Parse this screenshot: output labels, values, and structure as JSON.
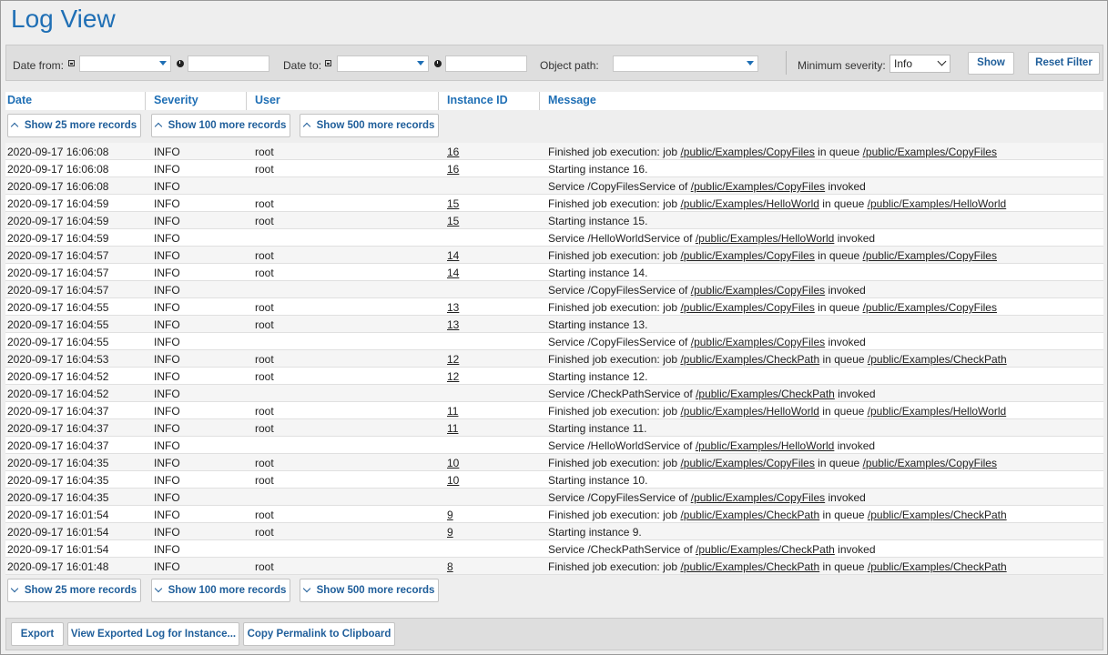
{
  "page": {
    "title": "Log View"
  },
  "filters": {
    "date_from_label": "Date from:",
    "date_to_label": "Date to:",
    "object_path_label": "Object path:",
    "min_severity_label": "Minimum severity:",
    "min_severity_value": "Info",
    "show_label": "Show",
    "reset_label": "Reset Filter"
  },
  "columns": {
    "date": "Date",
    "severity": "Severity",
    "user": "User",
    "instance": "Instance ID",
    "message": "Message"
  },
  "more_buttons": {
    "b25": "Show 25 more records",
    "b100": "Show 100 more records",
    "b500": "Show 500 more records"
  },
  "footer": {
    "export": "Export",
    "view_exported": "View Exported Log for Instance...",
    "copy_permalink": "Copy Permalink to Clipboard"
  },
  "rows": [
    {
      "date": "2020-09-17 16:06:08",
      "severity": "INFO",
      "user": "root",
      "instance": "16",
      "msg": [
        [
          "Finished job execution: job ",
          false
        ],
        [
          "/public/Examples/CopyFiles",
          true
        ],
        [
          " in queue ",
          false
        ],
        [
          "/public/Examples/CopyFiles",
          true
        ]
      ]
    },
    {
      "date": "2020-09-17 16:06:08",
      "severity": "INFO",
      "user": "root",
      "instance": "16",
      "msg": [
        [
          "Starting instance 16.",
          false
        ]
      ]
    },
    {
      "date": "2020-09-17 16:06:08",
      "severity": "INFO",
      "user": "",
      "instance": "",
      "msg": [
        [
          "Service /CopyFilesService of ",
          false
        ],
        [
          "/public/Examples/CopyFiles",
          true
        ],
        [
          " invoked",
          false
        ]
      ]
    },
    {
      "date": "2020-09-17 16:04:59",
      "severity": "INFO",
      "user": "root",
      "instance": "15",
      "msg": [
        [
          "Finished job execution: job ",
          false
        ],
        [
          "/public/Examples/HelloWorld",
          true
        ],
        [
          " in queue ",
          false
        ],
        [
          "/public/Examples/HelloWorld",
          true
        ]
      ]
    },
    {
      "date": "2020-09-17 16:04:59",
      "severity": "INFO",
      "user": "root",
      "instance": "15",
      "msg": [
        [
          "Starting instance 15.",
          false
        ]
      ]
    },
    {
      "date": "2020-09-17 16:04:59",
      "severity": "INFO",
      "user": "",
      "instance": "",
      "msg": [
        [
          "Service /HelloWorldService of ",
          false
        ],
        [
          "/public/Examples/HelloWorld",
          true
        ],
        [
          " invoked",
          false
        ]
      ]
    },
    {
      "date": "2020-09-17 16:04:57",
      "severity": "INFO",
      "user": "root",
      "instance": "14",
      "msg": [
        [
          "Finished job execution: job ",
          false
        ],
        [
          "/public/Examples/CopyFiles",
          true
        ],
        [
          " in queue ",
          false
        ],
        [
          "/public/Examples/CopyFiles",
          true
        ]
      ]
    },
    {
      "date": "2020-09-17 16:04:57",
      "severity": "INFO",
      "user": "root",
      "instance": "14",
      "msg": [
        [
          "Starting instance 14.",
          false
        ]
      ]
    },
    {
      "date": "2020-09-17 16:04:57",
      "severity": "INFO",
      "user": "",
      "instance": "",
      "msg": [
        [
          "Service /CopyFilesService of ",
          false
        ],
        [
          "/public/Examples/CopyFiles",
          true
        ],
        [
          " invoked",
          false
        ]
      ]
    },
    {
      "date": "2020-09-17 16:04:55",
      "severity": "INFO",
      "user": "root",
      "instance": "13",
      "msg": [
        [
          "Finished job execution: job ",
          false
        ],
        [
          "/public/Examples/CopyFiles",
          true
        ],
        [
          " in queue ",
          false
        ],
        [
          "/public/Examples/CopyFiles",
          true
        ]
      ]
    },
    {
      "date": "2020-09-17 16:04:55",
      "severity": "INFO",
      "user": "root",
      "instance": "13",
      "msg": [
        [
          "Starting instance 13.",
          false
        ]
      ]
    },
    {
      "date": "2020-09-17 16:04:55",
      "severity": "INFO",
      "user": "",
      "instance": "",
      "msg": [
        [
          "Service /CopyFilesService of ",
          false
        ],
        [
          "/public/Examples/CopyFiles",
          true
        ],
        [
          " invoked",
          false
        ]
      ]
    },
    {
      "date": "2020-09-17 16:04:53",
      "severity": "INFO",
      "user": "root",
      "instance": "12",
      "msg": [
        [
          "Finished job execution: job ",
          false
        ],
        [
          "/public/Examples/CheckPath",
          true
        ],
        [
          " in queue ",
          false
        ],
        [
          "/public/Examples/CheckPath",
          true
        ]
      ]
    },
    {
      "date": "2020-09-17 16:04:52",
      "severity": "INFO",
      "user": "root",
      "instance": "12",
      "msg": [
        [
          "Starting instance 12.",
          false
        ]
      ]
    },
    {
      "date": "2020-09-17 16:04:52",
      "severity": "INFO",
      "user": "",
      "instance": "",
      "msg": [
        [
          "Service /CheckPathService of ",
          false
        ],
        [
          "/public/Examples/CheckPath",
          true
        ],
        [
          " invoked",
          false
        ]
      ]
    },
    {
      "date": "2020-09-17 16:04:37",
      "severity": "INFO",
      "user": "root",
      "instance": "11",
      "msg": [
        [
          "Finished job execution: job ",
          false
        ],
        [
          "/public/Examples/HelloWorld",
          true
        ],
        [
          " in queue ",
          false
        ],
        [
          "/public/Examples/HelloWorld",
          true
        ]
      ]
    },
    {
      "date": "2020-09-17 16:04:37",
      "severity": "INFO",
      "user": "root",
      "instance": "11",
      "msg": [
        [
          "Starting instance 11.",
          false
        ]
      ]
    },
    {
      "date": "2020-09-17 16:04:37",
      "severity": "INFO",
      "user": "",
      "instance": "",
      "msg": [
        [
          "Service /HelloWorldService of ",
          false
        ],
        [
          "/public/Examples/HelloWorld",
          true
        ],
        [
          " invoked",
          false
        ]
      ]
    },
    {
      "date": "2020-09-17 16:04:35",
      "severity": "INFO",
      "user": "root",
      "instance": "10",
      "msg": [
        [
          "Finished job execution: job ",
          false
        ],
        [
          "/public/Examples/CopyFiles",
          true
        ],
        [
          " in queue ",
          false
        ],
        [
          "/public/Examples/CopyFiles",
          true
        ]
      ]
    },
    {
      "date": "2020-09-17 16:04:35",
      "severity": "INFO",
      "user": "root",
      "instance": "10",
      "msg": [
        [
          "Starting instance 10.",
          false
        ]
      ]
    },
    {
      "date": "2020-09-17 16:04:35",
      "severity": "INFO",
      "user": "",
      "instance": "",
      "msg": [
        [
          "Service /CopyFilesService of ",
          false
        ],
        [
          "/public/Examples/CopyFiles",
          true
        ],
        [
          " invoked",
          false
        ]
      ]
    },
    {
      "date": "2020-09-17 16:01:54",
      "severity": "INFO",
      "user": "root",
      "instance": "9",
      "msg": [
        [
          "Finished job execution: job ",
          false
        ],
        [
          "/public/Examples/CheckPath",
          true
        ],
        [
          " in queue ",
          false
        ],
        [
          "/public/Examples/CheckPath",
          true
        ]
      ]
    },
    {
      "date": "2020-09-17 16:01:54",
      "severity": "INFO",
      "user": "root",
      "instance": "9",
      "msg": [
        [
          "Starting instance 9.",
          false
        ]
      ]
    },
    {
      "date": "2020-09-17 16:01:54",
      "severity": "INFO",
      "user": "",
      "instance": "",
      "msg": [
        [
          "Service /CheckPathService of ",
          false
        ],
        [
          "/public/Examples/CheckPath",
          true
        ],
        [
          " invoked",
          false
        ]
      ]
    },
    {
      "date": "2020-09-17 16:01:48",
      "severity": "INFO",
      "user": "root",
      "instance": "8",
      "msg": [
        [
          "Finished job execution: job ",
          false
        ],
        [
          "/public/Examples/CheckPath",
          true
        ],
        [
          " in queue ",
          false
        ],
        [
          "/public/Examples/CheckPath",
          true
        ]
      ]
    }
  ]
}
